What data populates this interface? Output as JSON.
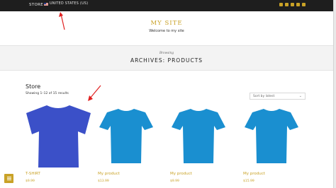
{
  "topbar": {
    "store_label": "STORE",
    "country_label": "UNITED STATES (US)",
    "social_icons": [
      "cart-icon",
      "bag-icon",
      "facebook-icon",
      "twitter-icon",
      "vimeo-icon"
    ]
  },
  "site": {
    "title": "MY SITE",
    "tagline": "Welcome to my site"
  },
  "archive": {
    "browsing_label": "Browsing",
    "title": "ARCHIVES: PRODUCTS"
  },
  "shop": {
    "section_title": "Store",
    "results_text": "Showing 1–12 of 15 results",
    "sort_selected": "Sort by latest"
  },
  "products": [
    {
      "name": "T-SHIRT",
      "price": "$9.99",
      "color": "#3b50c8"
    },
    {
      "name": "My product",
      "price": "$13.99",
      "color": "#1a8fd0"
    },
    {
      "name": "My product",
      "price": "$9.99",
      "color": "#1a8fd0"
    },
    {
      "name": "My product",
      "price": "$15.99",
      "color": "#1a8fd0"
    }
  ],
  "colors": {
    "accent": "#c9a227",
    "topbar": "#1e1e1e",
    "annotation_arrow": "#e02020"
  }
}
